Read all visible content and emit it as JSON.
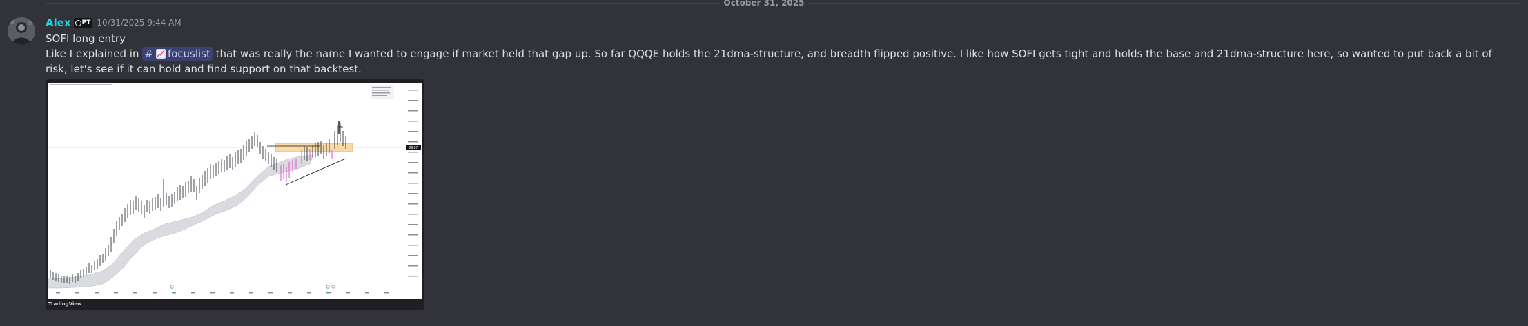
{
  "date_divider": "October 31, 2025",
  "message": {
    "username": "Alex",
    "tag": "PT",
    "timestamp": "10/31/2025 9:44 AM",
    "line1": "SOFI long entry",
    "line2_prefix": "Like I explained in ",
    "channel_name": "focuslist",
    "line2_suffix": " that was really the name I wanted to engage if market held that gap up. So far QQQE holds the 21dma-structure, and breadth flipped positive. I like how SOFI gets tight and holds the base and 21dma-structure here, so wanted to put back a bit of risk, let's see if it can hold and find support on that backtest.",
    "colors": {
      "username": "#1dd3e6",
      "mention_bg": "#3c4270",
      "background": "#313338"
    },
    "icons": {
      "channel": "hash-icon",
      "emoji": "chart-increasing-emoji",
      "tag": "tag-badge-icon"
    }
  },
  "attachment": {
    "footer_label": "TradingView",
    "chart_price_label": "29.87"
  }
}
